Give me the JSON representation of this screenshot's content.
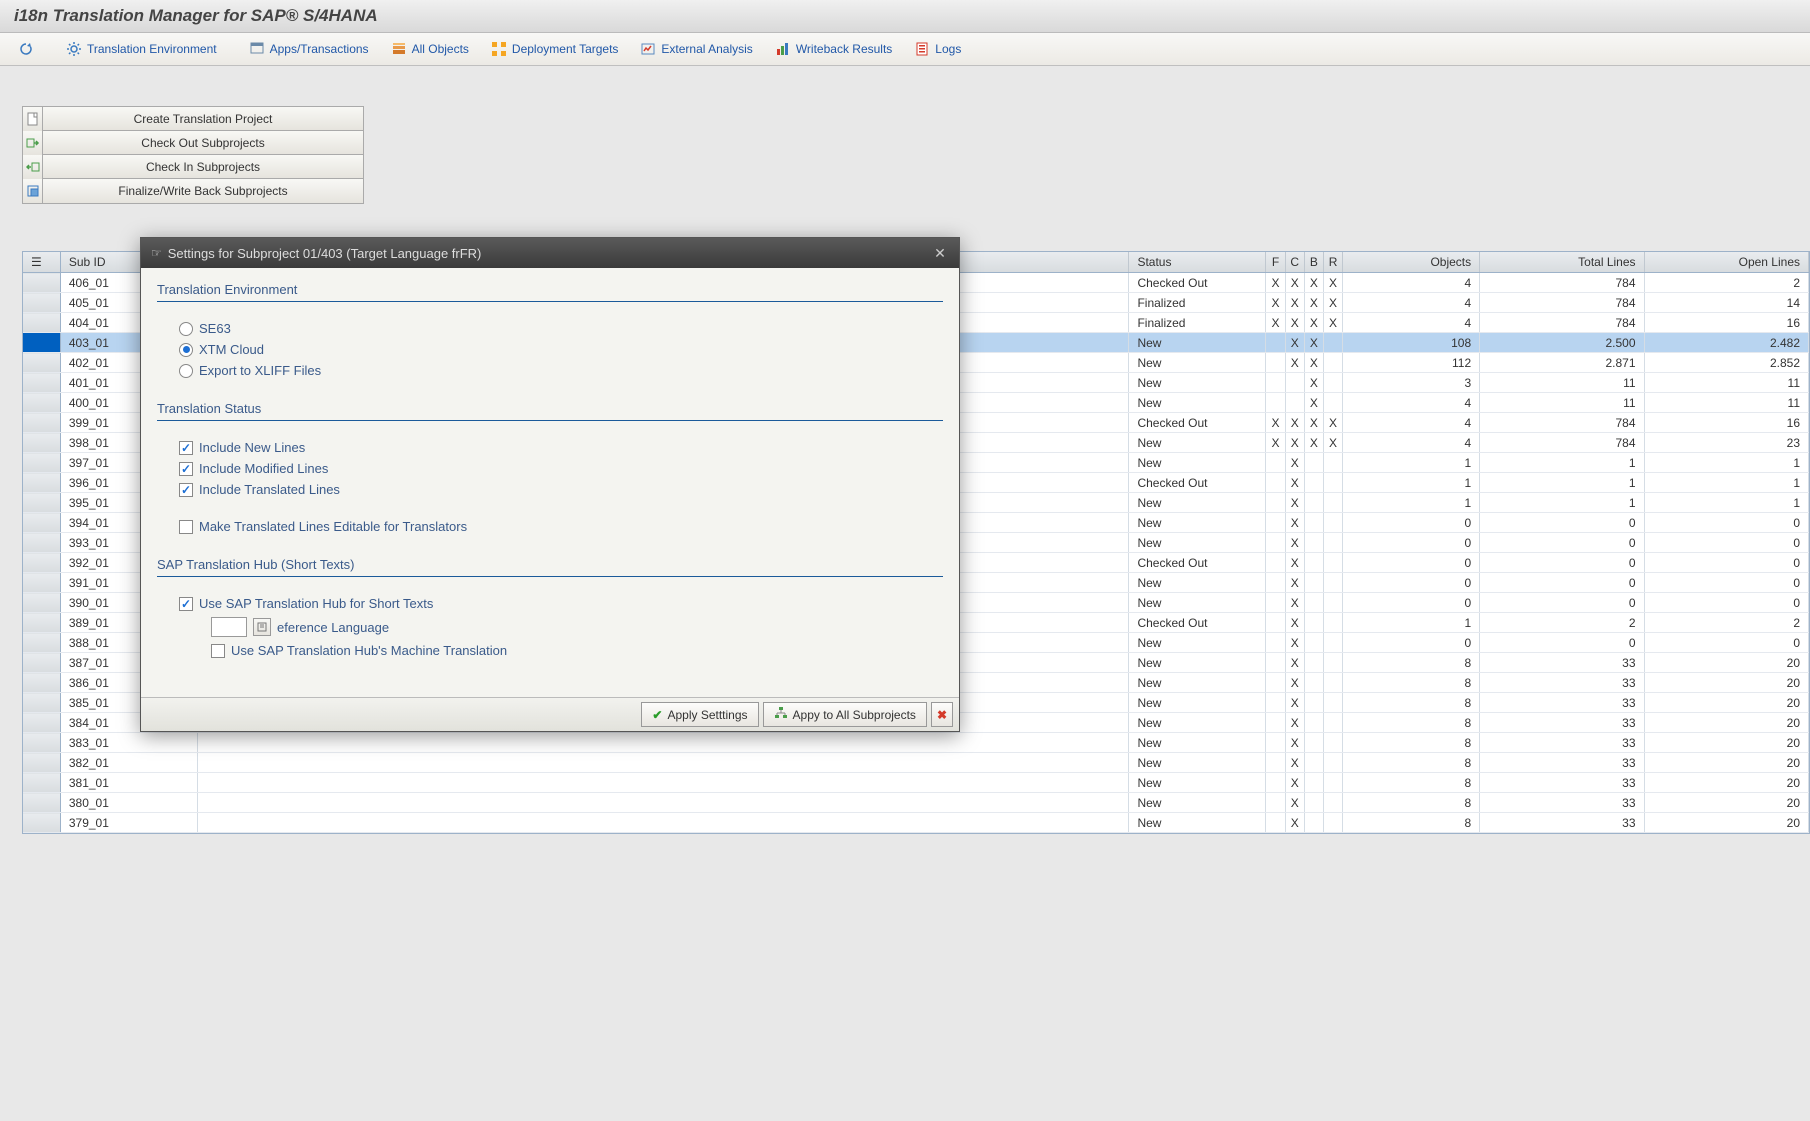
{
  "app_title": "i18n Translation Manager for SAP® S/4HANA",
  "toolbar": [
    {
      "name": "refresh-button",
      "icon": "refresh",
      "label": ""
    },
    {
      "name": "tab-translation-env",
      "icon": "gear",
      "label": "Translation Environment"
    },
    {
      "name": "tab-apps-transactions",
      "icon": "apps",
      "label": "Apps/Transactions"
    },
    {
      "name": "tab-all-objects",
      "icon": "stack",
      "label": "All Objects"
    },
    {
      "name": "tab-deployment-targets",
      "icon": "deploy",
      "label": "Deployment Targets"
    },
    {
      "name": "tab-external-analysis",
      "icon": "analysis",
      "label": "External Analysis"
    },
    {
      "name": "tab-writeback-results",
      "icon": "chart",
      "label": "Writeback Results"
    },
    {
      "name": "tab-logs",
      "icon": "logs",
      "label": "Logs"
    }
  ],
  "action_buttons": [
    {
      "name": "create-project-button",
      "icon": "new",
      "label": "Create Translation Project"
    },
    {
      "name": "checkout-subprojects-button",
      "icon": "checkout",
      "label": "Check Out Subprojects"
    },
    {
      "name": "checkin-subprojects-button",
      "icon": "checkin",
      "label": "Check In Subprojects"
    },
    {
      "name": "finalize-writeback-button",
      "icon": "finalize",
      "label": "Finalize/Write Back Subprojects"
    }
  ],
  "table_headers": {
    "list_icon": "☰",
    "sub_id": "Sub ID",
    "status": "Status",
    "f": "F",
    "c": "C",
    "b": "B",
    "r": "R",
    "objects": "Objects",
    "total_lines": "Total Lines",
    "open_lines": "Open Lines"
  },
  "rows": [
    {
      "sub": "406_01",
      "status": "Checked Out",
      "f": "X",
      "c": "X",
      "b": "X",
      "r": "X",
      "objects": "4",
      "total": "784",
      "open": "2",
      "sel": false
    },
    {
      "sub": "405_01",
      "status": "Finalized",
      "f": "X",
      "c": "X",
      "b": "X",
      "r": "X",
      "objects": "4",
      "total": "784",
      "open": "14",
      "sel": false
    },
    {
      "sub": "404_01",
      "status": "Finalized",
      "f": "X",
      "c": "X",
      "b": "X",
      "r": "X",
      "objects": "4",
      "total": "784",
      "open": "16",
      "sel": false
    },
    {
      "sub": "403_01",
      "status": "New",
      "f": "",
      "c": "X",
      "b": "X",
      "r": "",
      "objects": "108",
      "total": "2.500",
      "open": "2.482",
      "sel": true
    },
    {
      "sub": "402_01",
      "status": "New",
      "f": "",
      "c": "X",
      "b": "X",
      "r": "",
      "objects": "112",
      "total": "2.871",
      "open": "2.852",
      "sel": false
    },
    {
      "sub": "401_01",
      "status": "New",
      "f": "",
      "c": "",
      "b": "X",
      "r": "",
      "objects": "3",
      "total": "11",
      "open": "11",
      "sel": false
    },
    {
      "sub": "400_01",
      "status": "New",
      "f": "",
      "c": "",
      "b": "X",
      "r": "",
      "objects": "4",
      "total": "11",
      "open": "11",
      "sel": false
    },
    {
      "sub": "399_01",
      "status": "Checked Out",
      "f": "X",
      "c": "X",
      "b": "X",
      "r": "X",
      "objects": "4",
      "total": "784",
      "open": "16",
      "sel": false
    },
    {
      "sub": "398_01",
      "status": "New",
      "f": "X",
      "c": "X",
      "b": "X",
      "r": "X",
      "objects": "4",
      "total": "784",
      "open": "23",
      "sel": false
    },
    {
      "sub": "397_01",
      "status": "New",
      "f": "",
      "c": "X",
      "b": "",
      "r": "",
      "objects": "1",
      "total": "1",
      "open": "1",
      "sel": false
    },
    {
      "sub": "396_01",
      "status": "Checked Out",
      "f": "",
      "c": "X",
      "b": "",
      "r": "",
      "objects": "1",
      "total": "1",
      "open": "1",
      "sel": false
    },
    {
      "sub": "395_01",
      "status": "New",
      "f": "",
      "c": "X",
      "b": "",
      "r": "",
      "objects": "1",
      "total": "1",
      "open": "1",
      "sel": false
    },
    {
      "sub": "394_01",
      "status": "New",
      "f": "",
      "c": "X",
      "b": "",
      "r": "",
      "objects": "0",
      "total": "0",
      "open": "0",
      "sel": false
    },
    {
      "sub": "393_01",
      "status": "New",
      "f": "",
      "c": "X",
      "b": "",
      "r": "",
      "objects": "0",
      "total": "0",
      "open": "0",
      "sel": false
    },
    {
      "sub": "392_01",
      "status": "Checked Out",
      "f": "",
      "c": "X",
      "b": "",
      "r": "",
      "objects": "0",
      "total": "0",
      "open": "0",
      "sel": false
    },
    {
      "sub": "391_01",
      "status": "New",
      "f": "",
      "c": "X",
      "b": "",
      "r": "",
      "objects": "0",
      "total": "0",
      "open": "0",
      "sel": false
    },
    {
      "sub": "390_01",
      "status": "New",
      "f": "",
      "c": "X",
      "b": "",
      "r": "",
      "objects": "0",
      "total": "0",
      "open": "0",
      "sel": false
    },
    {
      "sub": "389_01",
      "status": "Checked Out",
      "f": "",
      "c": "X",
      "b": "",
      "r": "",
      "objects": "1",
      "total": "2",
      "open": "2",
      "sel": false
    },
    {
      "sub": "388_01",
      "status": "New",
      "f": "",
      "c": "X",
      "b": "",
      "r": "",
      "objects": "0",
      "total": "0",
      "open": "0",
      "sel": false
    },
    {
      "sub": "387_01",
      "status": "New",
      "f": "",
      "c": "X",
      "b": "",
      "r": "",
      "objects": "8",
      "total": "33",
      "open": "20",
      "sel": false
    },
    {
      "sub": "386_01",
      "status": "New",
      "f": "",
      "c": "X",
      "b": "",
      "r": "",
      "objects": "8",
      "total": "33",
      "open": "20",
      "sel": false
    },
    {
      "sub": "385_01",
      "status": "New",
      "f": "",
      "c": "X",
      "b": "",
      "r": "",
      "objects": "8",
      "total": "33",
      "open": "20",
      "sel": false
    },
    {
      "sub": "384_01",
      "status": "New",
      "f": "",
      "c": "X",
      "b": "",
      "r": "",
      "objects": "8",
      "total": "33",
      "open": "20",
      "sel": false
    },
    {
      "sub": "383_01",
      "status": "New",
      "f": "",
      "c": "X",
      "b": "",
      "r": "",
      "objects": "8",
      "total": "33",
      "open": "20",
      "sel": false
    },
    {
      "sub": "382_01",
      "status": "New",
      "f": "",
      "c": "X",
      "b": "",
      "r": "",
      "objects": "8",
      "total": "33",
      "open": "20",
      "sel": false
    },
    {
      "sub": "381_01",
      "status": "New",
      "f": "",
      "c": "X",
      "b": "",
      "r": "",
      "objects": "8",
      "total": "33",
      "open": "20",
      "sel": false
    },
    {
      "sub": "380_01",
      "status": "New",
      "f": "",
      "c": "X",
      "b": "",
      "r": "",
      "objects": "8",
      "total": "33",
      "open": "20",
      "sel": false
    },
    {
      "sub": "379_01",
      "status": "New",
      "f": "",
      "c": "X",
      "b": "",
      "r": "",
      "objects": "8",
      "total": "33",
      "open": "20",
      "sel": false
    }
  ],
  "dialog": {
    "title": "Settings for Subproject 01/403 (Target Language frFR)",
    "section1": "Translation Environment",
    "radio_se63": "SE63",
    "radio_xtm": "XTM Cloud",
    "radio_xliff": "Export to XLIFF Files",
    "section2": "Translation Status",
    "chk_new": "Include New Lines",
    "chk_mod": "Include Modified Lines",
    "chk_trans": "Include Translated Lines",
    "chk_editable": "Make Translated Lines Editable for Translators",
    "section3": "SAP Translation Hub (Short Texts)",
    "chk_sth": "Use SAP Translation Hub for Short Texts",
    "ref_lang_label": "eference Language",
    "chk_sth_mt": "Use SAP Translation Hub's Machine Translation",
    "btn_apply": "Apply Setttings",
    "btn_apply_all": "Appy to All Subprojects"
  },
  "radio_env_selected": "xtm",
  "chk_new": true,
  "chk_mod": true,
  "chk_trans": true,
  "chk_editable": false,
  "chk_sth": true,
  "chk_sth_mt": false,
  "ref_lang_value": ""
}
